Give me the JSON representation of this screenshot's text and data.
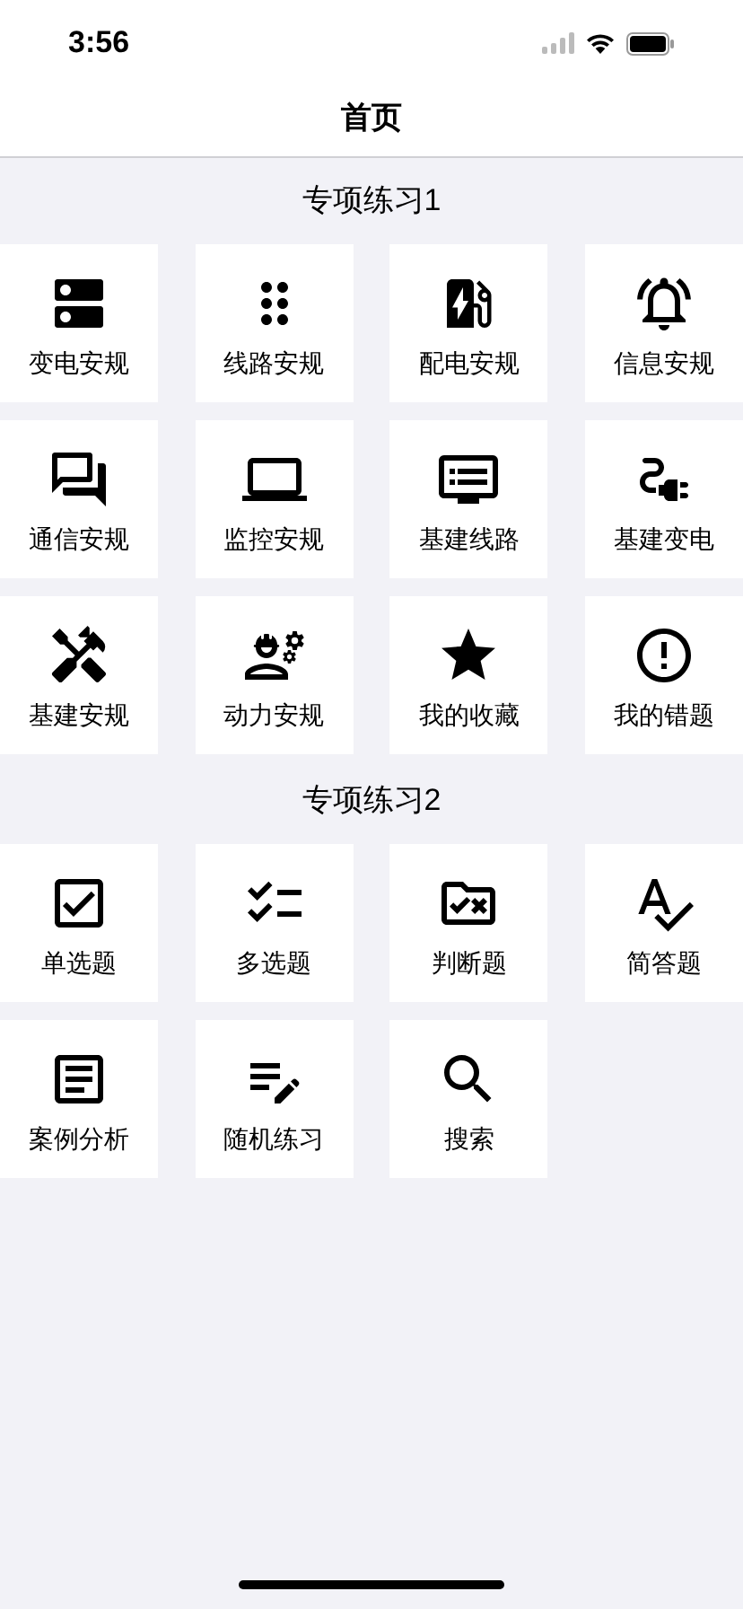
{
  "status_bar": {
    "time": "3:56"
  },
  "nav": {
    "title": "首页"
  },
  "sections": [
    {
      "title": "专项练习1",
      "items": [
        {
          "label": "变电安规"
        },
        {
          "label": "线路安规"
        },
        {
          "label": "配电安规"
        },
        {
          "label": "信息安规"
        },
        {
          "label": "通信安规"
        },
        {
          "label": "监控安规"
        },
        {
          "label": "基建线路"
        },
        {
          "label": "基建变电"
        },
        {
          "label": "基建安规"
        },
        {
          "label": "动力安规"
        },
        {
          "label": "我的收藏"
        },
        {
          "label": "我的错题"
        }
      ]
    },
    {
      "title": "专项练习2",
      "items": [
        {
          "label": "单选题"
        },
        {
          "label": "多选题"
        },
        {
          "label": "判断题"
        },
        {
          "label": "简答题"
        },
        {
          "label": "案例分析"
        },
        {
          "label": "随机练习"
        },
        {
          "label": "搜索"
        }
      ]
    }
  ]
}
